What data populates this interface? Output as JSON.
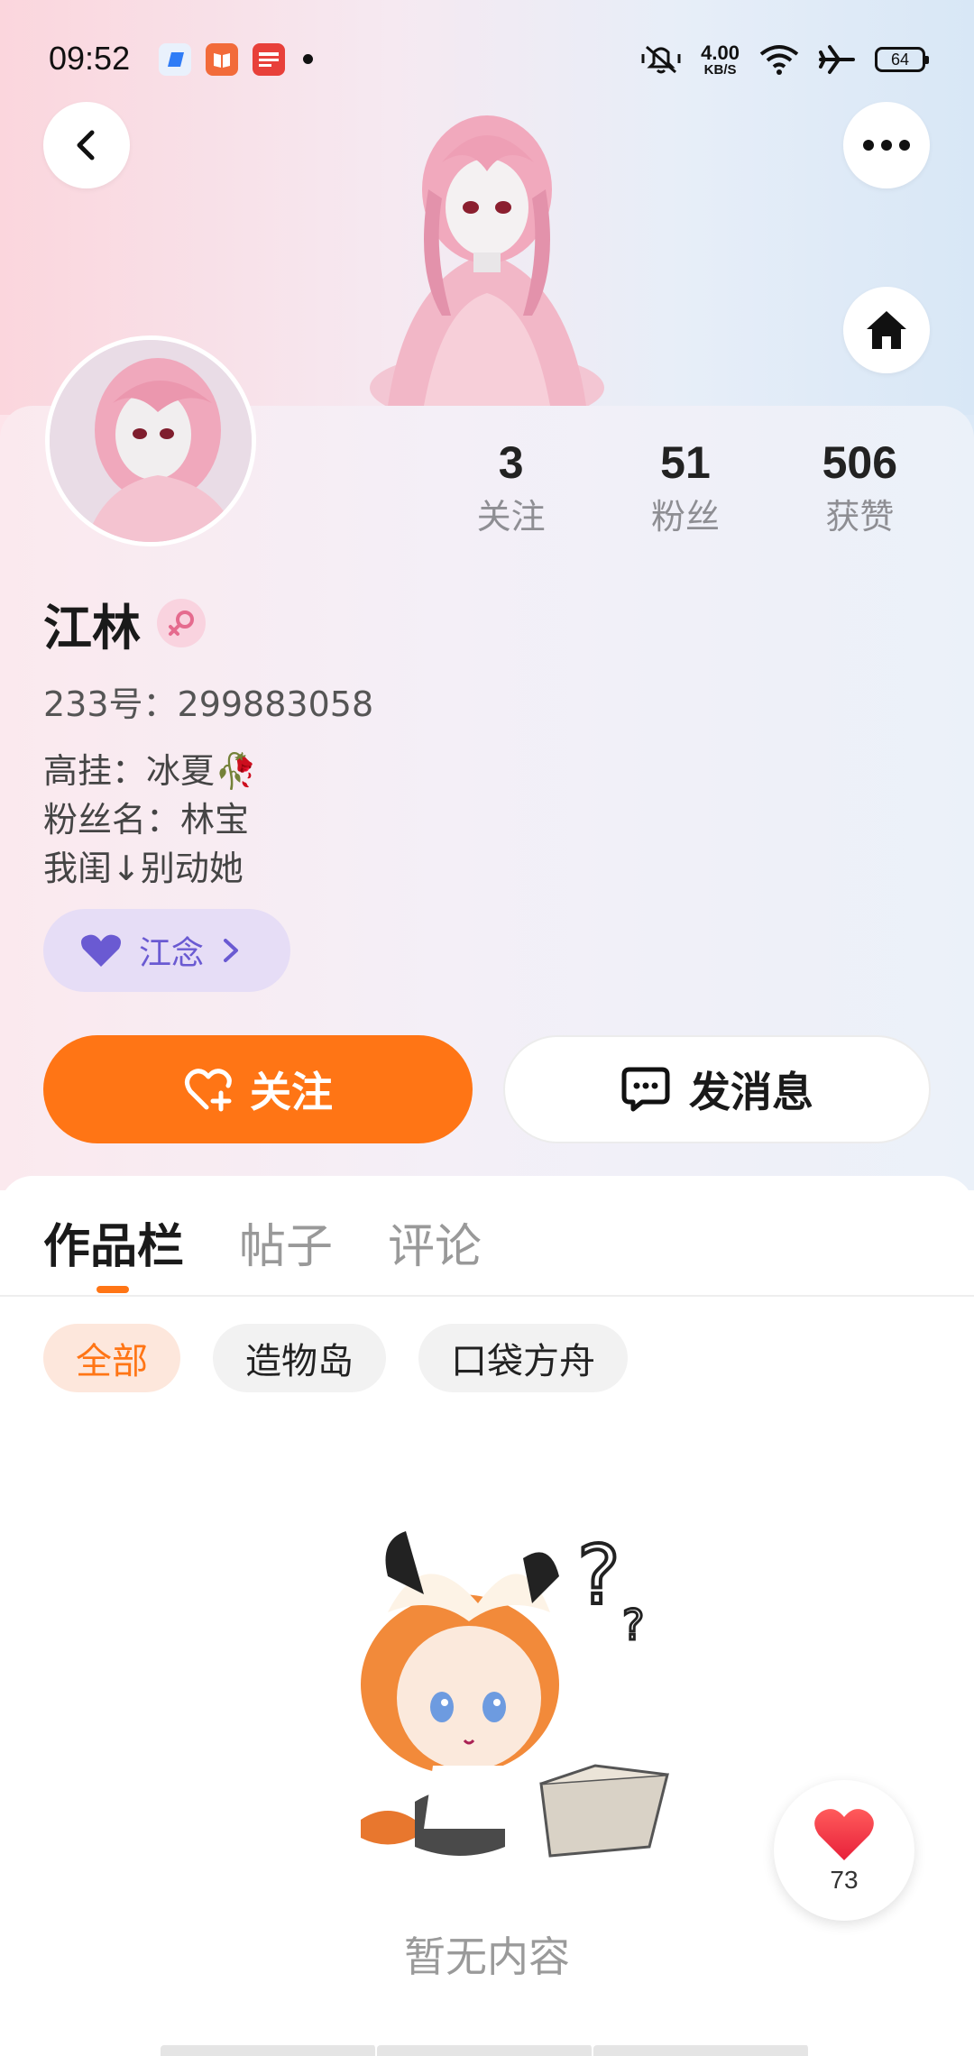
{
  "status_bar": {
    "time": "09:52",
    "net_speed_value": "4.00",
    "net_speed_unit": "KB/S",
    "battery": "64"
  },
  "header": {
    "back_icon": "chevron-left-icon",
    "more_icon": "more-dots-icon",
    "home_icon": "home-icon"
  },
  "profile": {
    "name": "江林",
    "gender_icon": "female-icon",
    "uid_text": "233号：299883058",
    "bio": [
      "高挂：冰夏🥀",
      "粉丝名：林宝",
      "我闺↓别动她"
    ],
    "stats": [
      {
        "value": "3",
        "label": "关注"
      },
      {
        "value": "51",
        "label": "粉丝"
      },
      {
        "value": "506",
        "label": "获赞"
      }
    ],
    "tag_label": "江念"
  },
  "actions": {
    "follow_label": "关注",
    "message_label": "发消息"
  },
  "tabs": [
    {
      "label": "作品栏",
      "active": true
    },
    {
      "label": "帖子",
      "active": false
    },
    {
      "label": "评论",
      "active": false
    }
  ],
  "filters": [
    {
      "label": "全部",
      "active": true
    },
    {
      "label": "造物岛",
      "active": false
    },
    {
      "label": "口袋方舟",
      "active": false
    }
  ],
  "empty": {
    "text": "暂无内容"
  },
  "like_fab": {
    "count": "73"
  },
  "colors": {
    "accent": "#ff7515",
    "tag_bg": "#e6ddf6",
    "tag_text": "#6a5ad2"
  }
}
